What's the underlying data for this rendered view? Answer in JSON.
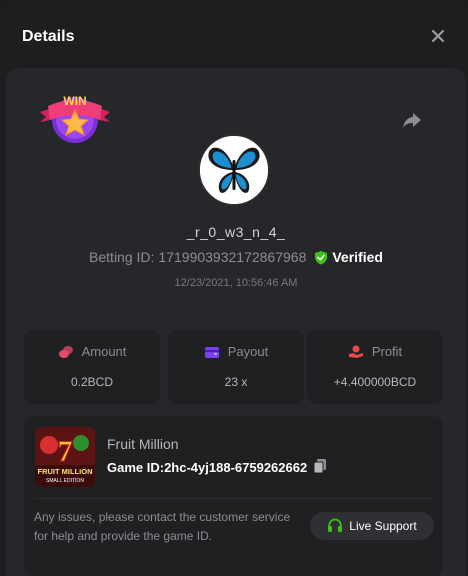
{
  "modal": {
    "title": "Details"
  },
  "player": {
    "username": "_r_0_w3_n_4_",
    "betting_id_label": "Betting ID:",
    "betting_id": "1719903932172867968",
    "verified_label": "Verified",
    "datetime": "12/23/2021, 10:56:46 AM",
    "badge_text": "WIN"
  },
  "stats": [
    {
      "label": "Amount",
      "value": "0.2BCD",
      "icon": "coins-icon"
    },
    {
      "label": "Payout",
      "value": "23 x",
      "icon": "wallet-icon"
    },
    {
      "label": "Profit",
      "value": "+4.400000BCD",
      "icon": "hand-coin-icon"
    }
  ],
  "game": {
    "name": "Fruit Million",
    "id_label": "Game ID:",
    "id": "2hc-4yj188-6759262662",
    "thumb_number": "7",
    "thumb_title": "FRUIT MILLION",
    "thumb_subtitle": "SMALL EDITION"
  },
  "support": {
    "help_text": "Any issues, please contact the customer service for help and provide the game ID.",
    "button_label": "Live Support"
  },
  "colors": {
    "amount_icon": "#e84a6a",
    "payout_icon": "#7b3ff2",
    "profit_icon": "#e84a4a",
    "verified_icon": "#3bc117",
    "support_icon": "#3bc117"
  }
}
